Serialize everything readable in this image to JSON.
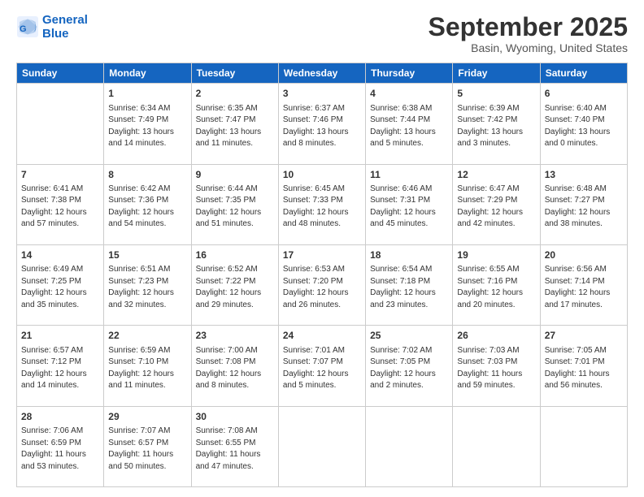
{
  "logo": {
    "line1": "General",
    "line2": "Blue"
  },
  "title": "September 2025",
  "subtitle": "Basin, Wyoming, United States",
  "headers": [
    "Sunday",
    "Monday",
    "Tuesday",
    "Wednesday",
    "Thursday",
    "Friday",
    "Saturday"
  ],
  "weeks": [
    [
      {
        "day": "",
        "sunrise": "",
        "sunset": "",
        "daylight": ""
      },
      {
        "day": "1",
        "sunrise": "Sunrise: 6:34 AM",
        "sunset": "Sunset: 7:49 PM",
        "daylight": "Daylight: 13 hours and 14 minutes."
      },
      {
        "day": "2",
        "sunrise": "Sunrise: 6:35 AM",
        "sunset": "Sunset: 7:47 PM",
        "daylight": "Daylight: 13 hours and 11 minutes."
      },
      {
        "day": "3",
        "sunrise": "Sunrise: 6:37 AM",
        "sunset": "Sunset: 7:46 PM",
        "daylight": "Daylight: 13 hours and 8 minutes."
      },
      {
        "day": "4",
        "sunrise": "Sunrise: 6:38 AM",
        "sunset": "Sunset: 7:44 PM",
        "daylight": "Daylight: 13 hours and 5 minutes."
      },
      {
        "day": "5",
        "sunrise": "Sunrise: 6:39 AM",
        "sunset": "Sunset: 7:42 PM",
        "daylight": "Daylight: 13 hours and 3 minutes."
      },
      {
        "day": "6",
        "sunrise": "Sunrise: 6:40 AM",
        "sunset": "Sunset: 7:40 PM",
        "daylight": "Daylight: 13 hours and 0 minutes."
      }
    ],
    [
      {
        "day": "7",
        "sunrise": "Sunrise: 6:41 AM",
        "sunset": "Sunset: 7:38 PM",
        "daylight": "Daylight: 12 hours and 57 minutes."
      },
      {
        "day": "8",
        "sunrise": "Sunrise: 6:42 AM",
        "sunset": "Sunset: 7:36 PM",
        "daylight": "Daylight: 12 hours and 54 minutes."
      },
      {
        "day": "9",
        "sunrise": "Sunrise: 6:44 AM",
        "sunset": "Sunset: 7:35 PM",
        "daylight": "Daylight: 12 hours and 51 minutes."
      },
      {
        "day": "10",
        "sunrise": "Sunrise: 6:45 AM",
        "sunset": "Sunset: 7:33 PM",
        "daylight": "Daylight: 12 hours and 48 minutes."
      },
      {
        "day": "11",
        "sunrise": "Sunrise: 6:46 AM",
        "sunset": "Sunset: 7:31 PM",
        "daylight": "Daylight: 12 hours and 45 minutes."
      },
      {
        "day": "12",
        "sunrise": "Sunrise: 6:47 AM",
        "sunset": "Sunset: 7:29 PM",
        "daylight": "Daylight: 12 hours and 42 minutes."
      },
      {
        "day": "13",
        "sunrise": "Sunrise: 6:48 AM",
        "sunset": "Sunset: 7:27 PM",
        "daylight": "Daylight: 12 hours and 38 minutes."
      }
    ],
    [
      {
        "day": "14",
        "sunrise": "Sunrise: 6:49 AM",
        "sunset": "Sunset: 7:25 PM",
        "daylight": "Daylight: 12 hours and 35 minutes."
      },
      {
        "day": "15",
        "sunrise": "Sunrise: 6:51 AM",
        "sunset": "Sunset: 7:23 PM",
        "daylight": "Daylight: 12 hours and 32 minutes."
      },
      {
        "day": "16",
        "sunrise": "Sunrise: 6:52 AM",
        "sunset": "Sunset: 7:22 PM",
        "daylight": "Daylight: 12 hours and 29 minutes."
      },
      {
        "day": "17",
        "sunrise": "Sunrise: 6:53 AM",
        "sunset": "Sunset: 7:20 PM",
        "daylight": "Daylight: 12 hours and 26 minutes."
      },
      {
        "day": "18",
        "sunrise": "Sunrise: 6:54 AM",
        "sunset": "Sunset: 7:18 PM",
        "daylight": "Daylight: 12 hours and 23 minutes."
      },
      {
        "day": "19",
        "sunrise": "Sunrise: 6:55 AM",
        "sunset": "Sunset: 7:16 PM",
        "daylight": "Daylight: 12 hours and 20 minutes."
      },
      {
        "day": "20",
        "sunrise": "Sunrise: 6:56 AM",
        "sunset": "Sunset: 7:14 PM",
        "daylight": "Daylight: 12 hours and 17 minutes."
      }
    ],
    [
      {
        "day": "21",
        "sunrise": "Sunrise: 6:57 AM",
        "sunset": "Sunset: 7:12 PM",
        "daylight": "Daylight: 12 hours and 14 minutes."
      },
      {
        "day": "22",
        "sunrise": "Sunrise: 6:59 AM",
        "sunset": "Sunset: 7:10 PM",
        "daylight": "Daylight: 12 hours and 11 minutes."
      },
      {
        "day": "23",
        "sunrise": "Sunrise: 7:00 AM",
        "sunset": "Sunset: 7:08 PM",
        "daylight": "Daylight: 12 hours and 8 minutes."
      },
      {
        "day": "24",
        "sunrise": "Sunrise: 7:01 AM",
        "sunset": "Sunset: 7:07 PM",
        "daylight": "Daylight: 12 hours and 5 minutes."
      },
      {
        "day": "25",
        "sunrise": "Sunrise: 7:02 AM",
        "sunset": "Sunset: 7:05 PM",
        "daylight": "Daylight: 12 hours and 2 minutes."
      },
      {
        "day": "26",
        "sunrise": "Sunrise: 7:03 AM",
        "sunset": "Sunset: 7:03 PM",
        "daylight": "Daylight: 11 hours and 59 minutes."
      },
      {
        "day": "27",
        "sunrise": "Sunrise: 7:05 AM",
        "sunset": "Sunset: 7:01 PM",
        "daylight": "Daylight: 11 hours and 56 minutes."
      }
    ],
    [
      {
        "day": "28",
        "sunrise": "Sunrise: 7:06 AM",
        "sunset": "Sunset: 6:59 PM",
        "daylight": "Daylight: 11 hours and 53 minutes."
      },
      {
        "day": "29",
        "sunrise": "Sunrise: 7:07 AM",
        "sunset": "Sunset: 6:57 PM",
        "daylight": "Daylight: 11 hours and 50 minutes."
      },
      {
        "day": "30",
        "sunrise": "Sunrise: 7:08 AM",
        "sunset": "Sunset: 6:55 PM",
        "daylight": "Daylight: 11 hours and 47 minutes."
      },
      {
        "day": "",
        "sunrise": "",
        "sunset": "",
        "daylight": ""
      },
      {
        "day": "",
        "sunrise": "",
        "sunset": "",
        "daylight": ""
      },
      {
        "day": "",
        "sunrise": "",
        "sunset": "",
        "daylight": ""
      },
      {
        "day": "",
        "sunrise": "",
        "sunset": "",
        "daylight": ""
      }
    ]
  ]
}
